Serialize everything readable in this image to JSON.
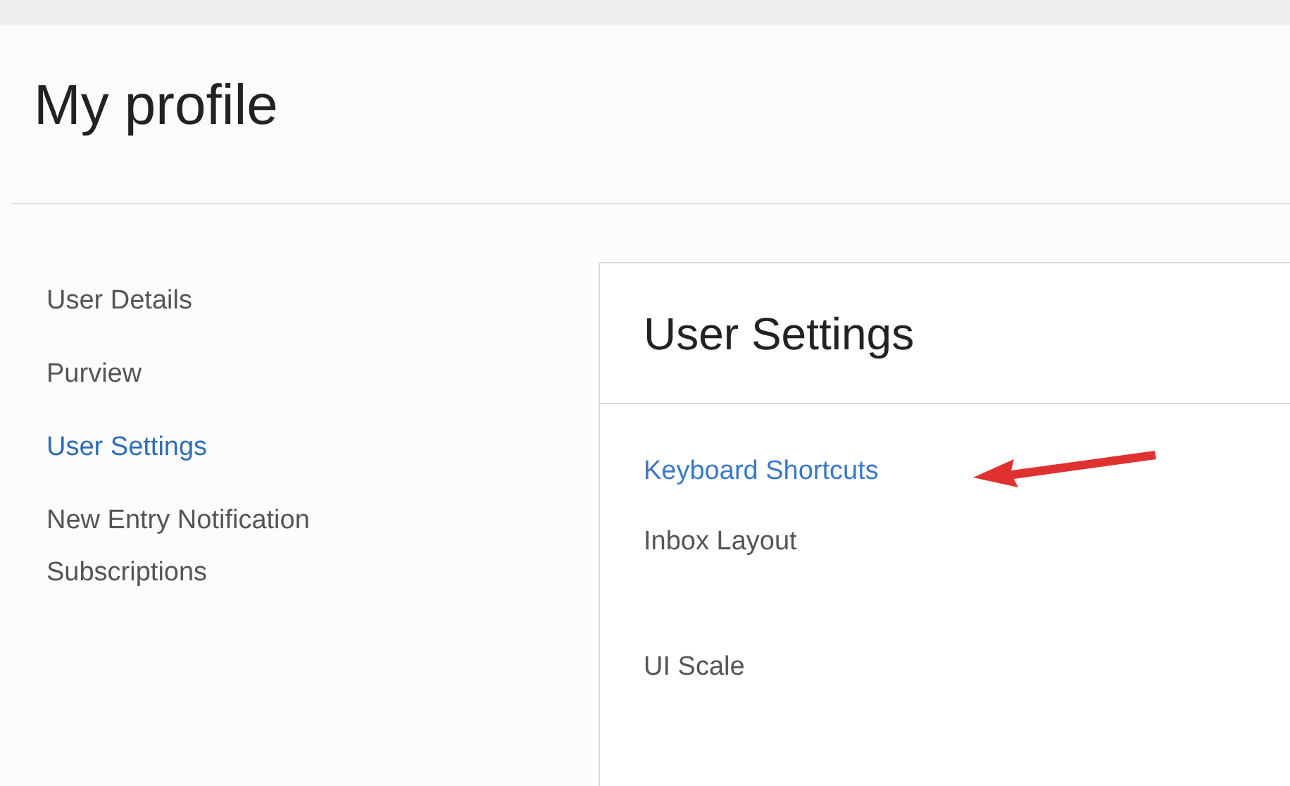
{
  "page": {
    "title": "My profile"
  },
  "sidebar": {
    "items": [
      {
        "label": "User Details",
        "selected": false
      },
      {
        "label": "Purview",
        "selected": false
      },
      {
        "label": "User Settings",
        "selected": true
      },
      {
        "label": "New Entry Notification Subscriptions",
        "selected": false
      }
    ]
  },
  "panel": {
    "title": "User Settings",
    "items": [
      {
        "label": "Keyboard Shortcuts",
        "kind": "link"
      },
      {
        "label": "Inbox Layout",
        "kind": "label"
      },
      {
        "label": "UI Scale",
        "kind": "label"
      }
    ]
  }
}
